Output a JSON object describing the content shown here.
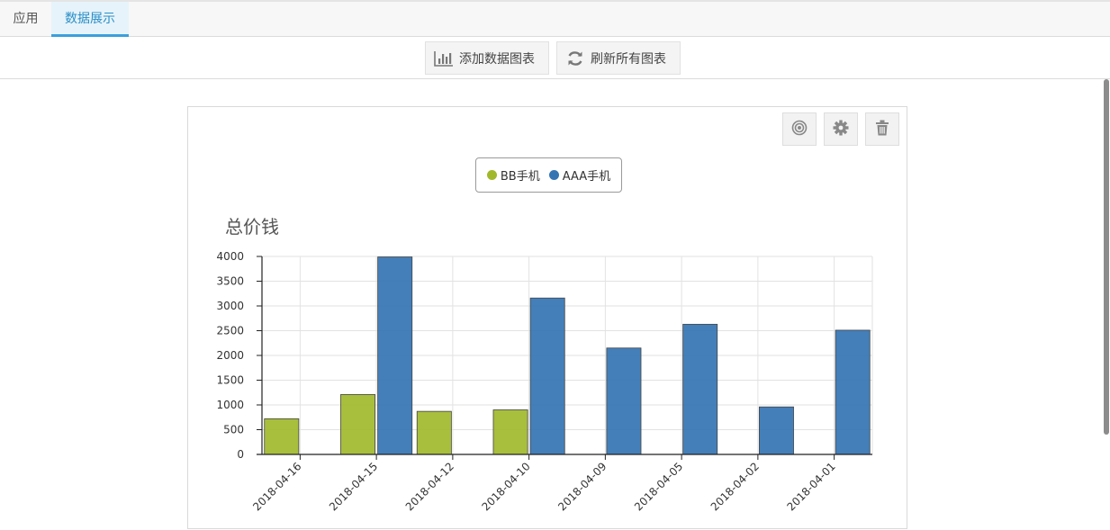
{
  "tabs": [
    {
      "label": "应用",
      "active": false
    },
    {
      "label": "数据展示",
      "active": true
    }
  ],
  "toolbar": {
    "add_chart_label": "添加数据图表",
    "refresh_all_label": "刷新所有图表"
  },
  "card_actions": {
    "target_icon": "target-icon",
    "settings_icon": "gear-icon",
    "delete_icon": "trash-icon"
  },
  "colors": {
    "accent": "#3aa0dc",
    "series_bb": "#a1b82c",
    "series_aaa": "#3474b3"
  },
  "chart_data": {
    "type": "bar",
    "title": "总价钱",
    "categories": [
      "2018-04-16",
      "2018-04-15",
      "2018-04-12",
      "2018-04-10",
      "2018-04-09",
      "2018-04-05",
      "2018-04-02",
      "2018-04-01"
    ],
    "series": [
      {
        "name": "BB手机",
        "color": "#a1b82c",
        "values": [
          720,
          1210,
          870,
          900,
          0,
          0,
          0,
          0
        ]
      },
      {
        "name": "AAA手机",
        "color": "#3474b3",
        "values": [
          0,
          3990,
          0,
          3160,
          2150,
          2630,
          960,
          2510
        ]
      }
    ],
    "y_ticks": [
      0,
      500,
      1000,
      1500,
      2000,
      2500,
      3000,
      3500,
      4000
    ],
    "ylim": [
      0,
      4000
    ],
    "grid": true,
    "legend_position": "top-center"
  }
}
